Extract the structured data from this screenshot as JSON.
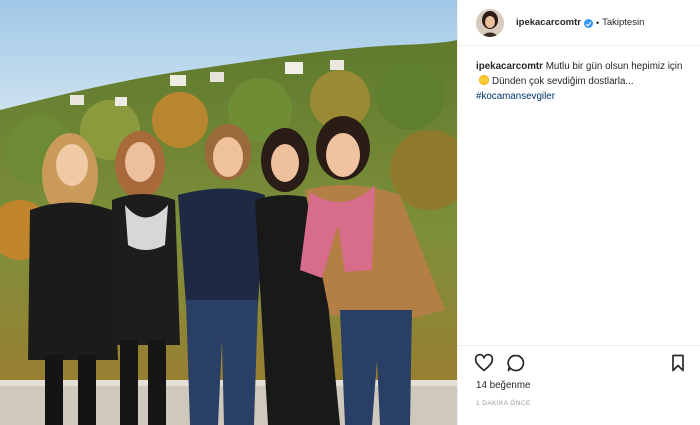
{
  "post": {
    "username": "ipekacarcomtr",
    "follow_state": "Takiptesin",
    "caption_user": "ipekacarcomtr",
    "caption_text_1": "Mutlu bir gün olsun hepimiz için",
    "caption_emoji": "sun",
    "caption_text_2": "Dünden çok sevdiğim dostlarla...",
    "hashtag": "#kocamansevgiler",
    "likes": "14 beğenme",
    "time_ago": "1 DAKİKA ÖNCE"
  },
  "icons": {
    "verified": "verified-badge-icon",
    "like": "heart-icon",
    "comment": "comment-icon",
    "save": "bookmark-icon"
  },
  "colors": {
    "link": "#003569",
    "verified": "#3897f0",
    "text": "#262626",
    "muted": "#999999"
  }
}
